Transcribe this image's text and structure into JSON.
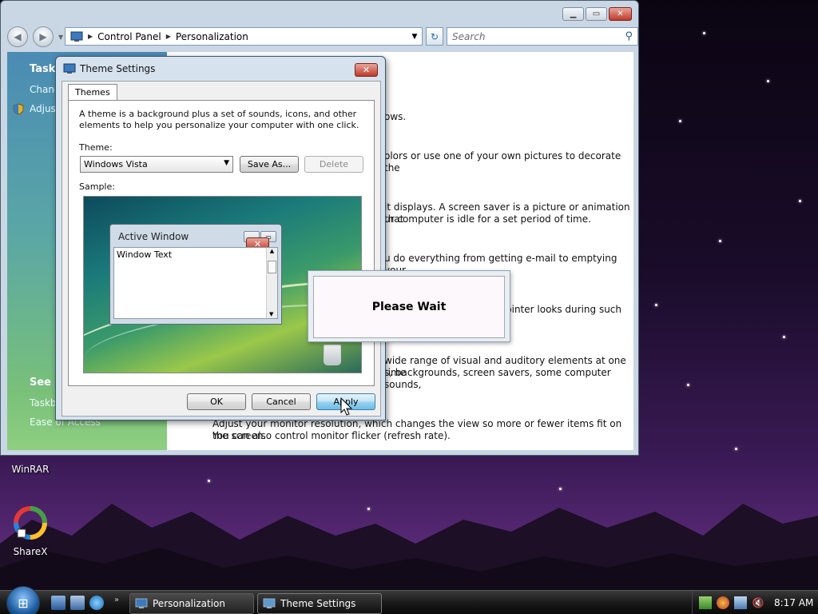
{
  "explorer": {
    "breadcrumb": [
      "Control Panel",
      "Personalization"
    ],
    "search_placeholder": "Search",
    "sidebar": {
      "tasks_heading": "Tasks",
      "task_links": [
        "Chang",
        "Adjust"
      ],
      "see_also_heading": "See al",
      "see_also_links": [
        "Taskba",
        "Ease of Access"
      ]
    },
    "main_lines": [
      "ows.",
      "olors or use one of your own pictures to decorate the",
      "it displays. A screen saver is a picture or animation that",
      "ur computer is idle for a set period of time.",
      "u do everything from getting e-mail to emptying your",
      "pinter looks during such",
      "wide range of visual and auditory elements at one time",
      "s, backgrounds, screen savers, some computer sounds,",
      "Adjust your monitor resolution, which changes the view so more or fewer items fit on the screen.",
      "You can also control monitor flicker (refresh rate)."
    ]
  },
  "dialog": {
    "title": "Theme Settings",
    "tab": "Themes",
    "description": [
      "A theme is a background plus a set of sounds, icons, and other",
      "elements to help you personalize your computer with one click."
    ],
    "theme_label": "Theme:",
    "theme_value": "Windows Vista",
    "save_as": "Save As...",
    "delete": "Delete",
    "sample_label": "Sample:",
    "active_window_title": "Active Window",
    "window_text": "Window Text",
    "ok": "OK",
    "cancel": "Cancel",
    "apply": "Apply"
  },
  "please_wait": "Please Wait",
  "desktop": {
    "icons": [
      "WinRAR",
      "ShareX"
    ]
  },
  "taskbar": {
    "tasks": [
      "Personalization",
      "Theme Settings"
    ],
    "clock": "8:17 AM"
  }
}
